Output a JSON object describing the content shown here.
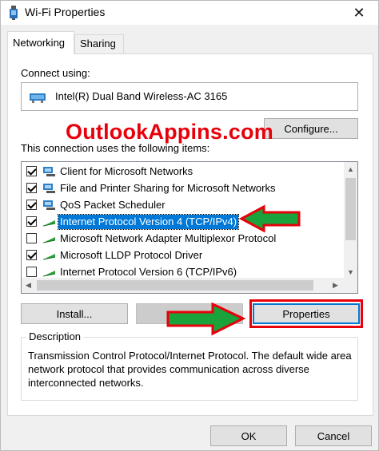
{
  "window": {
    "title": "Wi-Fi Properties",
    "close_glyph": "✕"
  },
  "tabs": [
    {
      "label": "Networking",
      "active": true
    },
    {
      "label": "Sharing",
      "active": false
    }
  ],
  "networking": {
    "connect_using_label": "Connect using:",
    "adapter_name": "Intel(R) Dual Band Wireless-AC 3165",
    "configure_button": "Configure...",
    "items_label": "This connection uses the following items:",
    "items": [
      {
        "label": "Client for Microsoft Networks",
        "checked": true,
        "icon": "network-client-icon",
        "selected": false
      },
      {
        "label": "File and Printer Sharing for Microsoft Networks",
        "checked": true,
        "icon": "file-printer-sharing-icon",
        "selected": false
      },
      {
        "label": "QoS Packet Scheduler",
        "checked": true,
        "icon": "qos-scheduler-icon",
        "selected": false
      },
      {
        "label": "Internet Protocol Version 4 (TCP/IPv4)",
        "checked": true,
        "icon": "protocol-icon",
        "selected": true
      },
      {
        "label": "Microsoft Network Adapter Multiplexor Protocol",
        "checked": false,
        "icon": "protocol-icon",
        "selected": false
      },
      {
        "label": "Microsoft LLDP Protocol Driver",
        "checked": true,
        "icon": "protocol-icon",
        "selected": false
      },
      {
        "label": "Internet Protocol Version 6 (TCP/IPv6)",
        "checked": false,
        "icon": "protocol-icon",
        "selected": false
      }
    ],
    "install_button": "Install...",
    "uninstall_button": "",
    "properties_button": "Properties",
    "description_legend": "Description",
    "description_text": "Transmission Control Protocol/Internet Protocol. The default wide area network protocol that provides communication across diverse interconnected networks."
  },
  "footer": {
    "ok_button": "OK",
    "cancel_button": "Cancel"
  },
  "watermark": {
    "text": "OutlookAppins.com",
    "color": "#e8000b"
  },
  "colors": {
    "selection": "#0078d7",
    "annotation_red": "#e8000b",
    "annotation_green": "#1aa33a"
  }
}
